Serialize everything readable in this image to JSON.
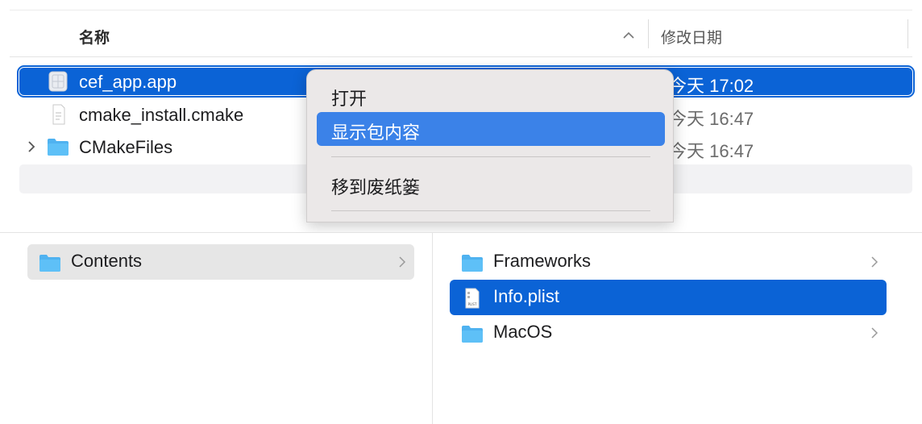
{
  "list": {
    "columns": {
      "name": "名称",
      "date": "修改日期"
    },
    "rows": [
      {
        "name": "cef_app.app",
        "date": "今天 17:02",
        "icon": "app-bundle-icon",
        "selected": true
      },
      {
        "name": "cmake_install.cmake",
        "date": "今天 16:47",
        "icon": "document-icon",
        "selected": false
      },
      {
        "name": "CMakeFiles",
        "date": "今天 16:47",
        "icon": "folder-icon",
        "selected": false
      }
    ]
  },
  "context_menu": {
    "items": [
      "打开",
      "显示包内容",
      "移到废纸篓"
    ],
    "highlighted_index": 1
  },
  "browser": {
    "column1": [
      {
        "label": "Contents",
        "icon": "folder-icon",
        "has_children": true
      }
    ],
    "column2": [
      {
        "label": "Frameworks",
        "icon": "folder-icon",
        "has_children": true
      },
      {
        "label": "Info.plist",
        "icon": "plist-file-icon",
        "has_children": false,
        "selected": true
      },
      {
        "label": "MacOS",
        "icon": "folder-icon",
        "has_children": true
      }
    ]
  },
  "colors": {
    "selection": "#0b63d6",
    "menu_highlight": "#3b82e8",
    "folder": "#4fb2f0"
  }
}
